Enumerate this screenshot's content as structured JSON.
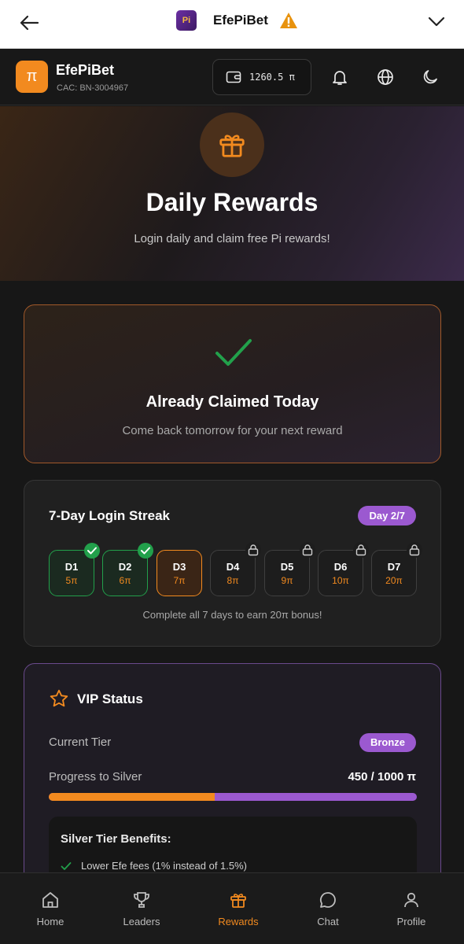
{
  "browser": {
    "title": "EfePiBet",
    "logo_text": "Pi"
  },
  "header": {
    "brand": "EfePiBet",
    "cac": "CAC: BN-3004967",
    "logo_symbol": "π",
    "wallet_amount": "1260.5 π"
  },
  "hero": {
    "title": "Daily Rewards",
    "subtitle": "Login daily and claim free Pi rewards!"
  },
  "claimed": {
    "title": "Already Claimed Today",
    "subtitle": "Come back tomorrow for your next reward"
  },
  "streak": {
    "title": "7-Day Login Streak",
    "badge": "Day 2/7",
    "days": [
      {
        "label": "D1",
        "value": "5π",
        "state": "done"
      },
      {
        "label": "D2",
        "value": "6π",
        "state": "done"
      },
      {
        "label": "D3",
        "value": "7π",
        "state": "today"
      },
      {
        "label": "D4",
        "value": "8π",
        "state": "locked"
      },
      {
        "label": "D5",
        "value": "9π",
        "state": "locked"
      },
      {
        "label": "D6",
        "value": "10π",
        "state": "locked"
      },
      {
        "label": "D7",
        "value": "20π",
        "state": "locked"
      }
    ],
    "note": "Complete all 7 days to earn 20π bonus!"
  },
  "vip": {
    "title": "VIP Status",
    "tier_label": "Current Tier",
    "tier": "Bronze",
    "progress_label": "Progress to Silver",
    "progress_value": "450 / 1000 π",
    "progress_fraction": 0.45,
    "benefits_title": "Silver Tier Benefits:",
    "benefits": [
      "Lower Efe fees (1% instead of 1.5%)"
    ]
  },
  "nav": {
    "items": [
      {
        "label": "Home",
        "icon": "home-icon"
      },
      {
        "label": "Leaders",
        "icon": "trophy-icon"
      },
      {
        "label": "Rewards",
        "icon": "gift-icon",
        "active": true
      },
      {
        "label": "Chat",
        "icon": "chat-icon"
      },
      {
        "label": "Profile",
        "icon": "user-icon"
      }
    ]
  },
  "colors": {
    "accent": "#f28a1f",
    "purple": "#9b59d0",
    "success": "#22a04b"
  }
}
